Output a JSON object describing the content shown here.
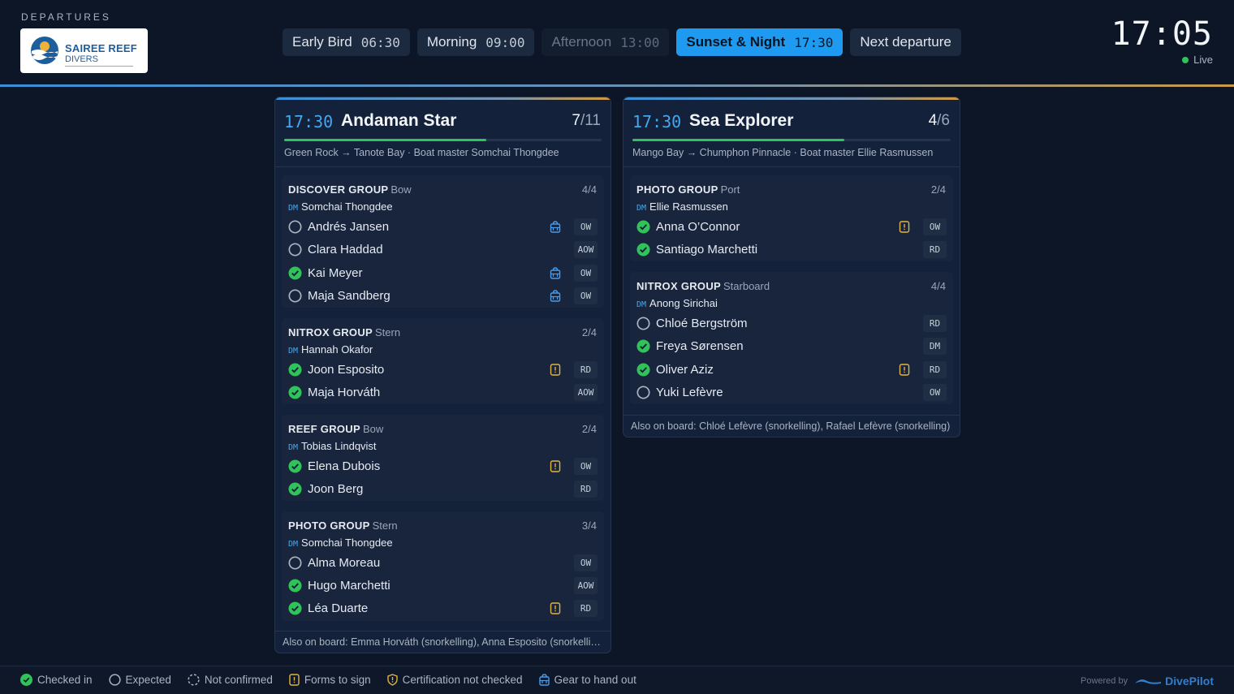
{
  "header": {
    "section_label": "DEPARTURES",
    "logo": {
      "line1": "SAIREE REEF",
      "line2": "DIVERS"
    },
    "tabs": [
      {
        "label": "Early Bird",
        "time": "06:30"
      },
      {
        "label": "Morning",
        "time": "09:00"
      },
      {
        "label": "Afternoon",
        "time": "13:00"
      },
      {
        "label": "Sunset & Night",
        "time": "17:30"
      },
      {
        "label": "Next departure",
        "time": ""
      }
    ],
    "clock": "17:05",
    "live_label": "Live"
  },
  "boats": [
    {
      "time": "17:30",
      "name": "Andaman Star",
      "count": "7",
      "total": "/11",
      "progress_fraction": 0.636,
      "route": "Green Rock → Tanote Bay · Boat master Somchai Thongdee",
      "groups": [
        {
          "title": "DISCOVER GROUP",
          "location": "Bow",
          "count": "4/4",
          "dm_badge": "DM",
          "dm_name": "Somchai Thongdee",
          "divers": [
            {
              "name": "Andrés Jansen",
              "status": "expected",
              "icon": "gear-icon",
              "cert": "OW"
            },
            {
              "name": "Clara Haddad",
              "status": "expected",
              "icon": "",
              "cert": "AOW"
            },
            {
              "name": "Kai Meyer",
              "status": "checked-in",
              "icon": "gear-icon",
              "cert": "OW"
            },
            {
              "name": "Maja Sandberg",
              "status": "expected",
              "icon": "gear-icon",
              "cert": "OW"
            }
          ]
        },
        {
          "title": "NITROX GROUP",
          "location": "Stern",
          "count": "2/4",
          "dm_badge": "DM",
          "dm_name": "Hannah Okafor",
          "divers": [
            {
              "name": "Joon Esposito",
              "status": "checked-in",
              "icon": "forms-icon",
              "cert": "RD"
            },
            {
              "name": "Maja Horváth",
              "status": "checked-in",
              "icon": "",
              "cert": "AOW"
            }
          ]
        },
        {
          "title": "REEF GROUP",
          "location": "Bow",
          "count": "2/4",
          "dm_badge": "DM",
          "dm_name": "Tobias Lindqvist",
          "divers": [
            {
              "name": "Elena Dubois",
              "status": "checked-in",
              "icon": "forms-icon",
              "cert": "OW"
            },
            {
              "name": "Joon Berg",
              "status": "checked-in",
              "icon": "",
              "cert": "RD"
            }
          ]
        },
        {
          "title": "PHOTO GROUP",
          "location": "Stern",
          "count": "3/4",
          "dm_badge": "DM",
          "dm_name": "Somchai Thongdee",
          "divers": [
            {
              "name": "Alma Moreau",
              "status": "expected",
              "icon": "",
              "cert": "OW"
            },
            {
              "name": "Hugo Marchetti",
              "status": "checked-in",
              "icon": "",
              "cert": "AOW"
            },
            {
              "name": "Léa Duarte",
              "status": "checked-in",
              "icon": "forms-icon",
              "cert": "RD"
            }
          ]
        }
      ],
      "also_on_board": "Also on board: Emma Horváth (snorkelling), Anna Esposito (snorkelling)"
    },
    {
      "time": "17:30",
      "name": "Sea Explorer",
      "count": "4",
      "total": "/6",
      "progress_fraction": 0.667,
      "route": "Mango Bay → Chumphon Pinnacle · Boat master Ellie Rasmussen",
      "groups": [
        {
          "title": "PHOTO GROUP",
          "location": "Port",
          "count": "2/4",
          "dm_badge": "DM",
          "dm_name": "Ellie Rasmussen",
          "divers": [
            {
              "name": "Anna O’Connor",
              "status": "checked-in",
              "icon": "forms-icon",
              "cert": "OW"
            },
            {
              "name": "Santiago Marchetti",
              "status": "checked-in",
              "icon": "",
              "cert": "RD"
            }
          ]
        },
        {
          "title": "NITROX GROUP",
          "location": "Starboard",
          "count": "4/4",
          "dm_badge": "DM",
          "dm_name": "Anong Sirichai",
          "divers": [
            {
              "name": "Chloé Bergström",
              "status": "expected",
              "icon": "",
              "cert": "RD"
            },
            {
              "name": "Freya Sørensen",
              "status": "checked-in",
              "icon": "",
              "cert": "DM"
            },
            {
              "name": "Oliver Aziz",
              "status": "checked-in",
              "icon": "forms-icon",
              "cert": "RD"
            },
            {
              "name": "Yuki Lefèvre",
              "status": "expected",
              "icon": "",
              "cert": "OW"
            }
          ]
        }
      ],
      "also_on_board": "Also on board: Chloé Lefèvre (snorkelling), Rafael Lefèvre (snorkelling)"
    }
  ],
  "legend": [
    {
      "icon": "check-circle-icon",
      "label": "Checked in"
    },
    {
      "icon": "circle-icon",
      "label": "Expected"
    },
    {
      "icon": "dashed-circle-icon",
      "label": "Not confirmed"
    },
    {
      "icon": "forms-icon",
      "label": "Forms to sign"
    },
    {
      "icon": "shield-icon",
      "label": "Certification not checked"
    },
    {
      "icon": "gear-icon",
      "label": "Gear to hand out"
    }
  ],
  "powered": {
    "label": "Powered by",
    "brand": "DivePilot"
  },
  "colors": {
    "accent": "#1e9bf0",
    "checked": "#2fc35a",
    "forms": "#e2b53c",
    "gear": "#4a9be8",
    "background": "#0d1626"
  }
}
